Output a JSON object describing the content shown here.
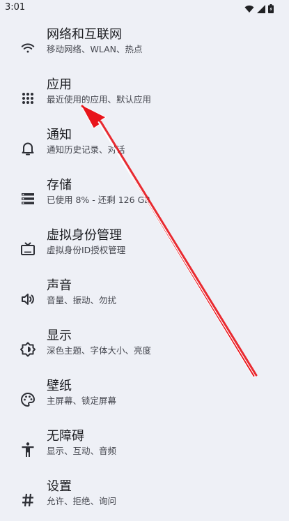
{
  "status_bar": {
    "time": "3:01",
    "icons": [
      "wifi-icon",
      "signal-icon",
      "battery-icon"
    ]
  },
  "settings": {
    "items": [
      {
        "id": "network",
        "icon": "wifi-icon",
        "title": "网络和互联网",
        "subtitle": "移动网络、WLAN、热点"
      },
      {
        "id": "apps",
        "icon": "apps-grid-icon",
        "title": "应用",
        "subtitle": "最近使用的应用、默认应用"
      },
      {
        "id": "notifications",
        "icon": "bell-icon",
        "title": "通知",
        "subtitle": "通知历史记录、对话"
      },
      {
        "id": "storage",
        "icon": "storage-icon",
        "title": "存储",
        "subtitle": "已使用 8% - 还剩 126 GB"
      },
      {
        "id": "virtual-identity",
        "icon": "tv-icon",
        "title": "虚拟身份管理",
        "subtitle": "虚拟身份ID授权管理"
      },
      {
        "id": "sound",
        "icon": "speaker-icon",
        "title": "声音",
        "subtitle": "音量、振动、勿扰"
      },
      {
        "id": "display",
        "icon": "brightness-icon",
        "title": "显示",
        "subtitle": "深色主题、字体大小、亮度"
      },
      {
        "id": "wallpaper",
        "icon": "palette-icon",
        "title": "壁纸",
        "subtitle": "主屏幕、锁定屏幕"
      },
      {
        "id": "accessibility",
        "icon": "accessibility-icon",
        "title": "无障碍",
        "subtitle": "显示、互动、音频"
      },
      {
        "id": "settings",
        "icon": "hash-icon",
        "title": "设置",
        "subtitle": "允许、拒绝、询问"
      }
    ]
  },
  "colors": {
    "background": "#eef0f6",
    "text_primary": "#1b1c20",
    "text_secondary": "#44464e",
    "annotation_arrow": "#e8141b"
  }
}
